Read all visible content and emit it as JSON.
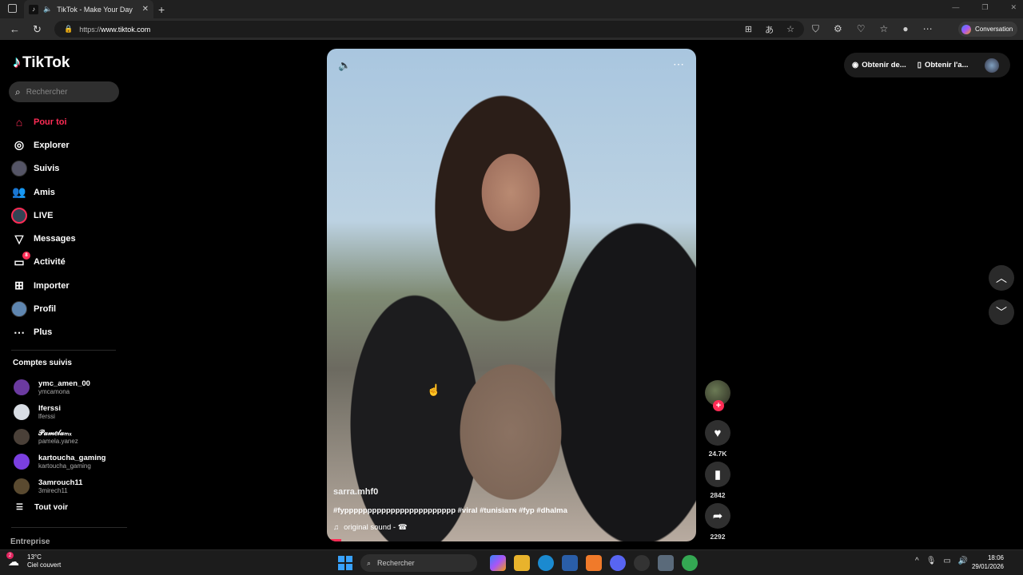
{
  "browser": {
    "tab_title": "TikTok - Make Your Day",
    "url_prefix": "https://",
    "url_domain": "www.tiktok.com",
    "conversation_label": "Conversation"
  },
  "sidebar": {
    "logo": "TikTok",
    "search_placeholder": "Rechercher",
    "menu": [
      {
        "label": "Pour toi",
        "icon": "home-icon"
      },
      {
        "label": "Explorer",
        "icon": "compass-icon"
      },
      {
        "label": "Suivis",
        "icon": "avatar"
      },
      {
        "label": "Amis",
        "icon": "friends-icon"
      },
      {
        "label": "LIVE",
        "icon": "live-icon"
      },
      {
        "label": "Messages",
        "icon": "send-icon"
      },
      {
        "label": "Activité",
        "icon": "inbox-icon",
        "badge": "8"
      },
      {
        "label": "Importer",
        "icon": "upload-icon"
      },
      {
        "label": "Profil",
        "icon": "profile-avatar"
      },
      {
        "label": "Plus",
        "icon": "more-icon"
      }
    ],
    "following_title": "Comptes suivis",
    "following": [
      {
        "name": "ymc_amen_00",
        "username": "ymcamona",
        "color": "#6b3aa0"
      },
      {
        "name": "lferssi",
        "username": "lferssi",
        "color": "#d8dde4"
      },
      {
        "name": "𝒫𝒶𝓂𝑒𝓁𝒶ₘₓ",
        "username": "pamela.yanez",
        "color": "#4a4038"
      },
      {
        "name": "kartoucha_gaming",
        "username": "kartoucha_gaming",
        "color": "#7b3fe0"
      },
      {
        "name": "3amrouch11",
        "username": "3mirech11",
        "color": "#5a4a30"
      }
    ],
    "see_all": "Tout voir",
    "entreprise": "Entreprise"
  },
  "video": {
    "author": "sarra.mhf0",
    "description": "#fypppppppppppppppppppppppp #viral #tunisiaᴛɴ #fyp #dhalma",
    "sound": "original sound - ☎",
    "progress_percent": 4
  },
  "actions": {
    "likes": "24.7K",
    "saves": "2842",
    "shares": "2292"
  },
  "topright": {
    "get_coins": "Obtenir de...",
    "get_app": "Obtenir l'a..."
  },
  "taskbar": {
    "temp": "13°C",
    "weather": "Ciel couvert",
    "weather_badge": "2",
    "search": "Rechercher",
    "time": "18:06",
    "date": "29/01/2026"
  }
}
